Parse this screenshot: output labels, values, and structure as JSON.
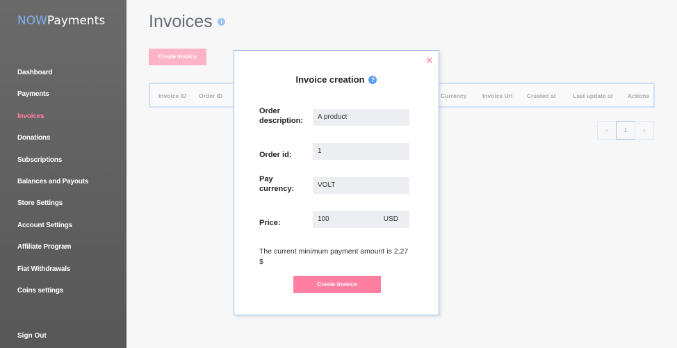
{
  "logo": {
    "now": "NOW",
    "payments": "Payments"
  },
  "sidebar": {
    "items": [
      {
        "label": "Dashboard"
      },
      {
        "label": "Payments"
      },
      {
        "label": "Invoices"
      },
      {
        "label": "Donations"
      },
      {
        "label": "Subscriptions"
      },
      {
        "label": "Balances and Payouts"
      },
      {
        "label": "Store Settings"
      },
      {
        "label": "Account Settings"
      },
      {
        "label": "Affiliate Program"
      },
      {
        "label": "Fiat Withdrawals"
      },
      {
        "label": "Coins settings"
      }
    ],
    "sign_out": "Sign Out",
    "active": "Invoices"
  },
  "page": {
    "title": "Invoices",
    "info_icon": "i",
    "create_label": "Create Invoice"
  },
  "table": {
    "columns": [
      "Invoice ID",
      "Order ID",
      "Currency",
      "Invoice Url",
      "Created at",
      "Last update at",
      "Actions"
    ]
  },
  "pagination": {
    "prev": "«",
    "page": "1",
    "next": "»"
  },
  "modal": {
    "title": "Invoice creation",
    "help_icon": "?",
    "close_icon": "×",
    "fields": {
      "order_description_label": "Order description:",
      "order_description": "A product",
      "order_id_label": "Order id:",
      "order_id": "1",
      "pay_currency_label": "Pay currency:",
      "pay_currency": "VOLT",
      "price_label": "Price:",
      "price": "100",
      "price_currency": "USD"
    },
    "note": "The current minimum payment amount is 2,27 $",
    "submit_label": "Create Invoice"
  }
}
